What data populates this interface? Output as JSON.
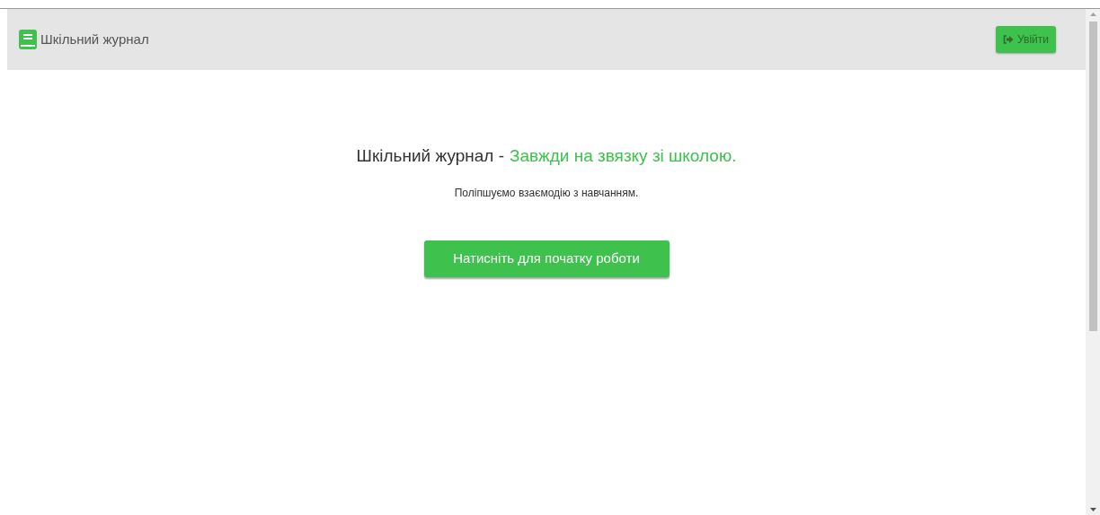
{
  "navbar": {
    "brand": "Шкільний журнал",
    "login_button": "Увійти"
  },
  "hero": {
    "title": "Шкільний журнал -",
    "tagline": "Завжди на звязку зі школою.",
    "subtitle": "Поліпшуємо взаємодію з навчанням.",
    "start_button": "Натисніть для початку роботи"
  }
}
